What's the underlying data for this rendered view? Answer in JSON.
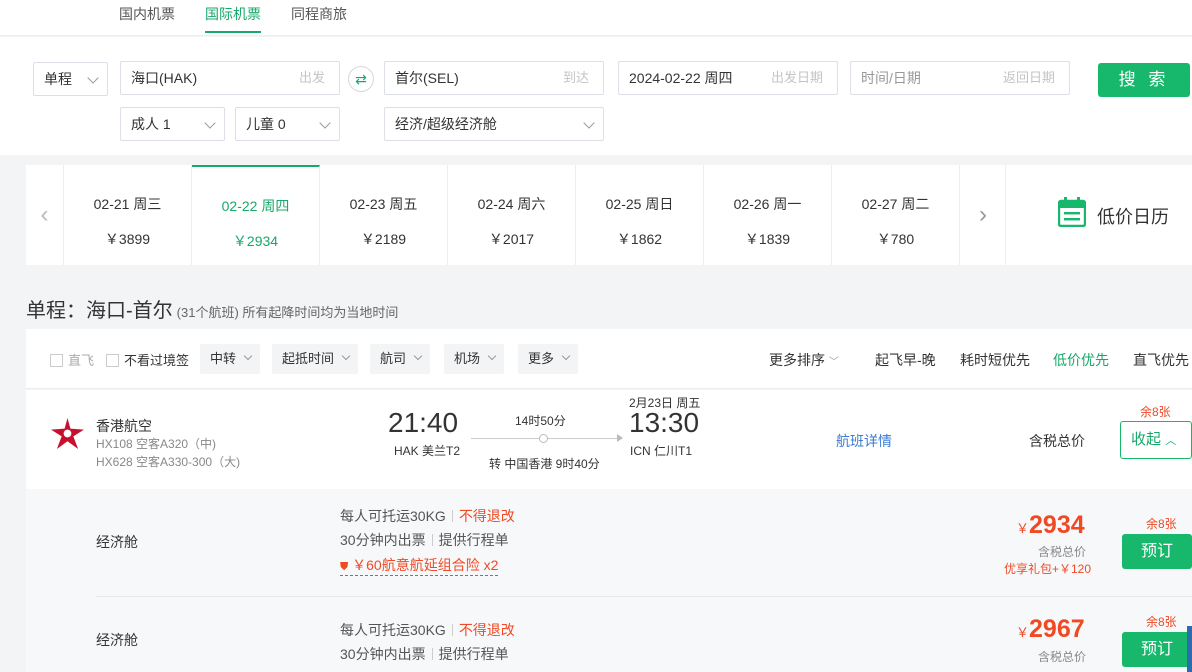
{
  "top_tabs": [
    {
      "label": "国内机票",
      "active": false
    },
    {
      "label": "国际机票",
      "active": true
    },
    {
      "label": "同程商旅",
      "active": false
    }
  ],
  "search": {
    "trip_type": "单程",
    "from_value": "海口(HAK)",
    "from_hint": "出发",
    "to_value": "首尔(SEL)",
    "to_hint": "到达",
    "depart_value": "2024-02-22 周四",
    "depart_hint": "出发日期",
    "return_placeholder": "时间/日期",
    "return_hint": "返回日期",
    "search_label": "搜 索",
    "adults": "成人 1",
    "children": "儿童 0",
    "cabin": "经济/超级经济舱"
  },
  "date_strip": [
    {
      "date": "02-21 周三",
      "price": "￥3899",
      "active": false
    },
    {
      "date": "02-22 周四",
      "price": "￥2934",
      "active": true
    },
    {
      "date": "02-23 周五",
      "price": "￥2189",
      "active": false
    },
    {
      "date": "02-24 周六",
      "price": "￥2017",
      "active": false
    },
    {
      "date": "02-25 周日",
      "price": "￥1862",
      "active": false
    },
    {
      "date": "02-26 周一",
      "price": "￥1839",
      "active": false
    },
    {
      "date": "02-27 周二",
      "price": "￥780",
      "active": false
    }
  ],
  "calendar_label": "低价日历",
  "heading": {
    "title": "单程：海口-首尔",
    "subtitle": "(31个航班) 所有起降时间均为当地时间"
  },
  "filters": {
    "direct": "直飞",
    "no_transit_visa": "不看过境签",
    "dropdowns": [
      "中转",
      "起抵时间",
      "航司",
      "机场",
      "更多"
    ],
    "sort_more": "更多排序",
    "sorts": [
      {
        "label": "起飞早-晚",
        "active": false
      },
      {
        "label": "耗时短优先",
        "active": false
      },
      {
        "label": "低价优先",
        "active": true
      },
      {
        "label": "直飞优先",
        "active": false
      }
    ]
  },
  "flight": {
    "airline": "香港航空",
    "leg1": "HX108 空客A320（中)",
    "leg2": "HX628 空客A330-300（大)",
    "dep_time": "21:40",
    "dep_airport": "HAK 美兰T2",
    "duration": "14时50分",
    "transfer": "转 中国香港 9时40分",
    "arr_date": "2月23日 周五",
    "arr_time": "13:30",
    "arr_airport": "ICN 仁川T1",
    "details_link": "航班详情",
    "price_label": "含税总价",
    "seats_left": "余8张",
    "collapse_label": "收起"
  },
  "fares": [
    {
      "cabin": "经济舱",
      "baggage": "每人可托运30KG",
      "refund": "不得退改",
      "issue": "30分钟内出票",
      "itinerary": "提供行程单",
      "insurance": "￥60航意航延组合险",
      "insurance_qty": "x2",
      "price": "2934",
      "price_label": "含税总价",
      "bonus": "优享礼包+￥120",
      "seats": "余8张",
      "book": "预订"
    },
    {
      "cabin": "经济舱",
      "baggage": "每人可托运30KG",
      "refund": "不得退改",
      "issue": "30分钟内出票",
      "itinerary": "提供行程单",
      "price": "2967",
      "price_label": "含税总价",
      "seats": "余8张",
      "book": "预订"
    }
  ],
  "currency_symbol": "￥",
  "colors": {
    "brand_green": "#17b86c",
    "price_red": "#f04a25",
    "airline_red": "#c8102e"
  }
}
